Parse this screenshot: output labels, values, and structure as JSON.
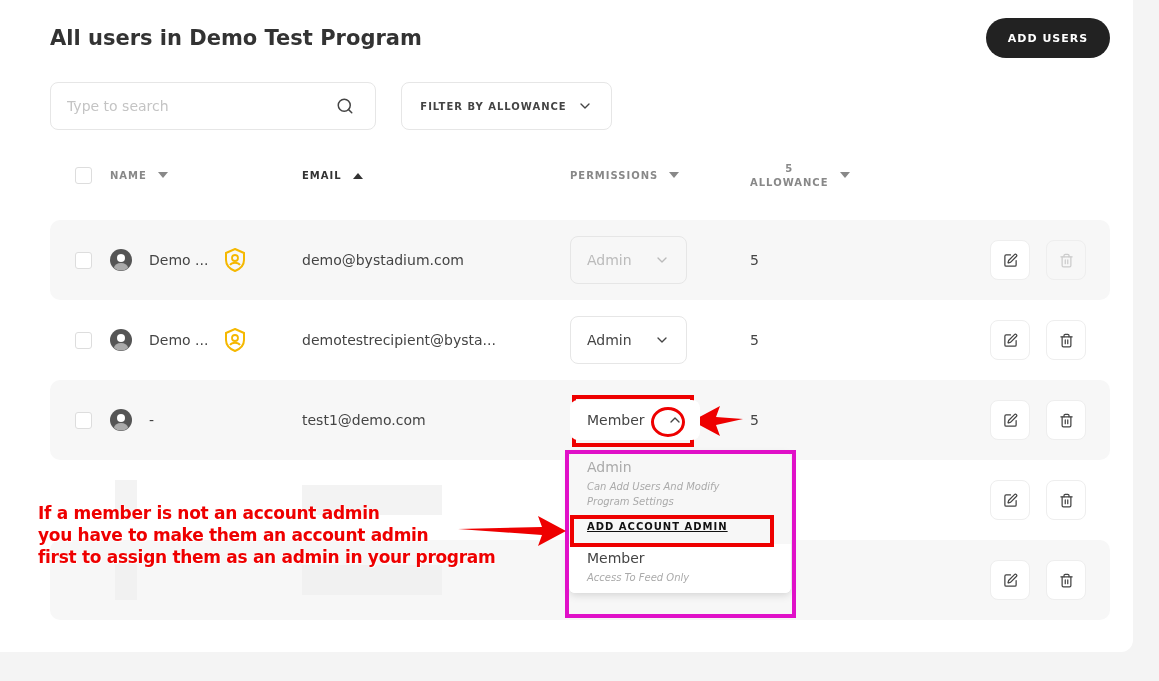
{
  "header": {
    "title": "All users in Demo Test Program",
    "add_button": "ADD USERS"
  },
  "search": {
    "placeholder": "Type to search"
  },
  "filter": {
    "label": "FILTER BY ALLOWANCE"
  },
  "table": {
    "select_all": {
      "checked": false
    },
    "columns": [
      {
        "label": "NAME",
        "ascending": false,
        "active": false
      },
      {
        "label": "EMAIL",
        "ascending": true,
        "active": true
      },
      {
        "label": "PERMISSIONS",
        "ascending": false,
        "active": false
      },
      {
        "label": "ALLOWANCE",
        "count": "5",
        "ascending": false,
        "active": false
      }
    ],
    "rows": [
      {
        "kind": "user",
        "checked": false,
        "name": "Demo ...",
        "admin_badge": true,
        "email": "demo@bystadium.com",
        "permission": "Admin",
        "permission_disabled": true,
        "open": false,
        "allowance": "5",
        "delete_disabled": true
      },
      {
        "kind": "user",
        "checked": false,
        "name": "Demo ...",
        "admin_badge": true,
        "email": "demotestrecipient@bysta...",
        "permission": "Admin",
        "permission_disabled": false,
        "open": false,
        "allowance": "5",
        "delete_disabled": false
      },
      {
        "kind": "user",
        "checked": false,
        "name": "-",
        "admin_badge": false,
        "email": "test1@demo.com",
        "permission": "Member",
        "permission_disabled": false,
        "open": true,
        "allowance": "5",
        "delete_disabled": false
      },
      {
        "kind": "redacted",
        "delete_disabled": false
      },
      {
        "kind": "redacted",
        "delete_disabled": false
      }
    ]
  },
  "dropdown": {
    "options": [
      {
        "label": "Admin",
        "description": "Can Add Users And Modify Program Settings",
        "disabled": true,
        "link": "ADD ACCOUNT ADMIN"
      },
      {
        "label": "Member",
        "description": "Access To Feed Only",
        "disabled": false
      }
    ]
  },
  "annotation": {
    "lines": [
      "If a member is not an account admin",
      "you have to make them an account admin",
      "first to assign them as an admin in your program"
    ]
  }
}
